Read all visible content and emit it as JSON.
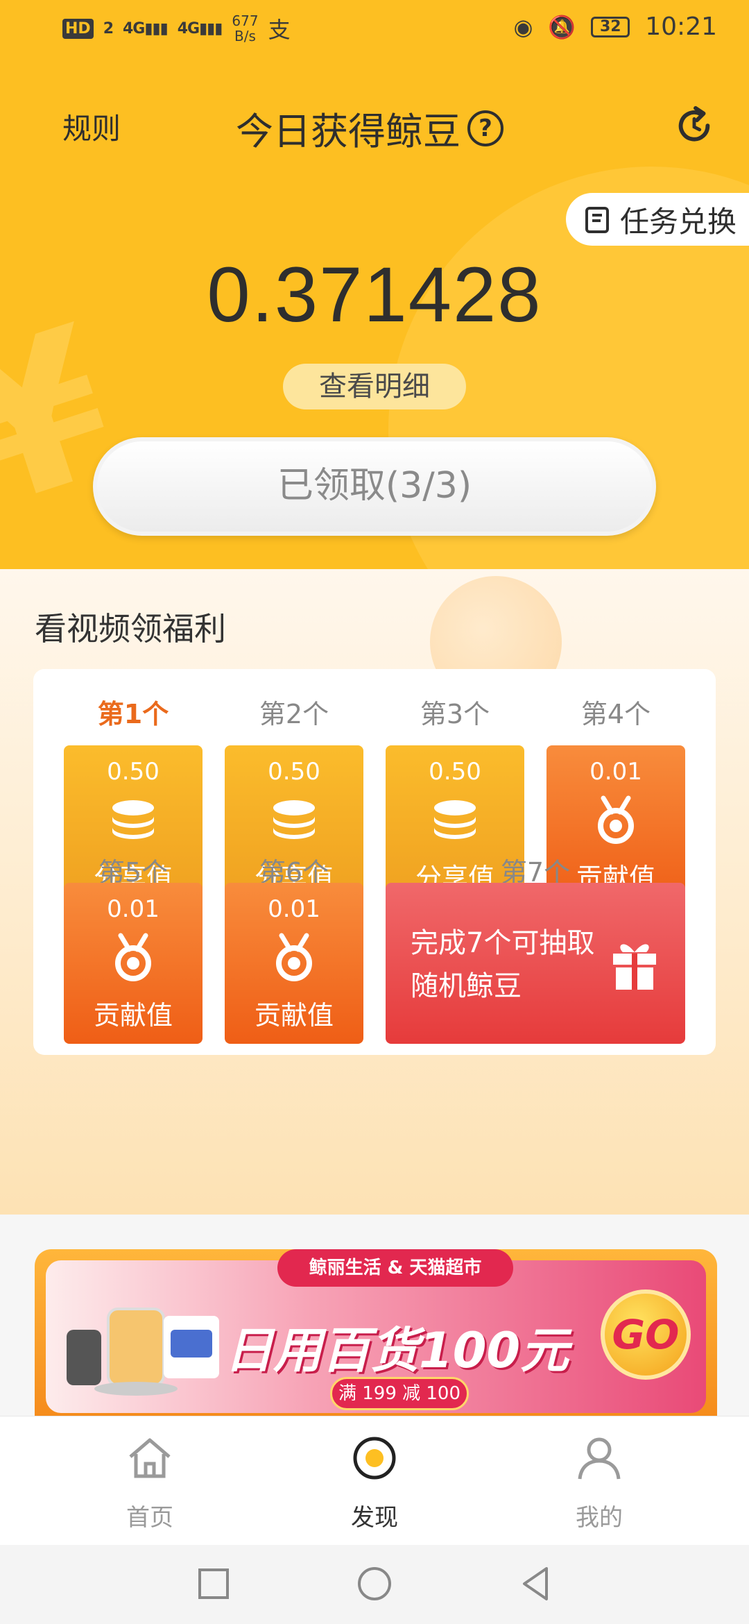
{
  "status_bar": {
    "network_badge": "HD",
    "sim_index": "2",
    "signal_1": "4G",
    "signal_2": "4G",
    "speed_value": "677",
    "speed_unit": "B/s",
    "extra_icon": "支",
    "battery": "32",
    "time": "10:21"
  },
  "header": {
    "rules_label": "规则",
    "title": "今日获得鲸豆",
    "help_symbol": "?"
  },
  "exchange_button": {
    "label": "任务兑换"
  },
  "balance": {
    "value": "0.371428"
  },
  "detail_button": {
    "label": "查看明细"
  },
  "claim_button": {
    "label": "已领取(3/3)"
  },
  "welfare": {
    "title": "看视频领福利",
    "slots": [
      {
        "label": "第1个",
        "value": "0.50",
        "name": "分享值",
        "icon": "coin-stack-icon",
        "active": true
      },
      {
        "label": "第2个",
        "value": "0.50",
        "name": "分享值",
        "icon": "coin-stack-icon",
        "active": false
      },
      {
        "label": "第3个",
        "value": "0.50",
        "name": "分享值",
        "icon": "coin-stack-icon",
        "active": false
      },
      {
        "label": "第4个",
        "value": "0.01",
        "name": "贡献值",
        "icon": "medal-icon",
        "active": false
      },
      {
        "label": "第5个",
        "value": "0.01",
        "name": "贡献值",
        "icon": "medal-icon",
        "active": false
      },
      {
        "label": "第6个",
        "value": "0.01",
        "name": "贡献值",
        "icon": "medal-icon",
        "active": false
      }
    ],
    "bonus": {
      "label": "第7个",
      "line1": "完成7个可抽取",
      "line2": "随机鲸豆",
      "icon": "gift-icon"
    }
  },
  "banner": {
    "tag": "鲸丽生活 & 天猫超市",
    "headline": "日用百货100元",
    "sub": "满 199 减 100",
    "go": "GO"
  },
  "bottom_nav": [
    {
      "label": "首页",
      "icon": "home-icon",
      "active": false
    },
    {
      "label": "发现",
      "icon": "discover-icon",
      "active": true
    },
    {
      "label": "我的",
      "icon": "profile-icon",
      "active": false
    }
  ],
  "colors": {
    "brand_yellow": "#fdbf22",
    "share_tile": "#f5ad24",
    "contrib_tile": "#f3722a",
    "bonus_tile": "#ea4f4f",
    "active_label": "#ea6a1c"
  }
}
